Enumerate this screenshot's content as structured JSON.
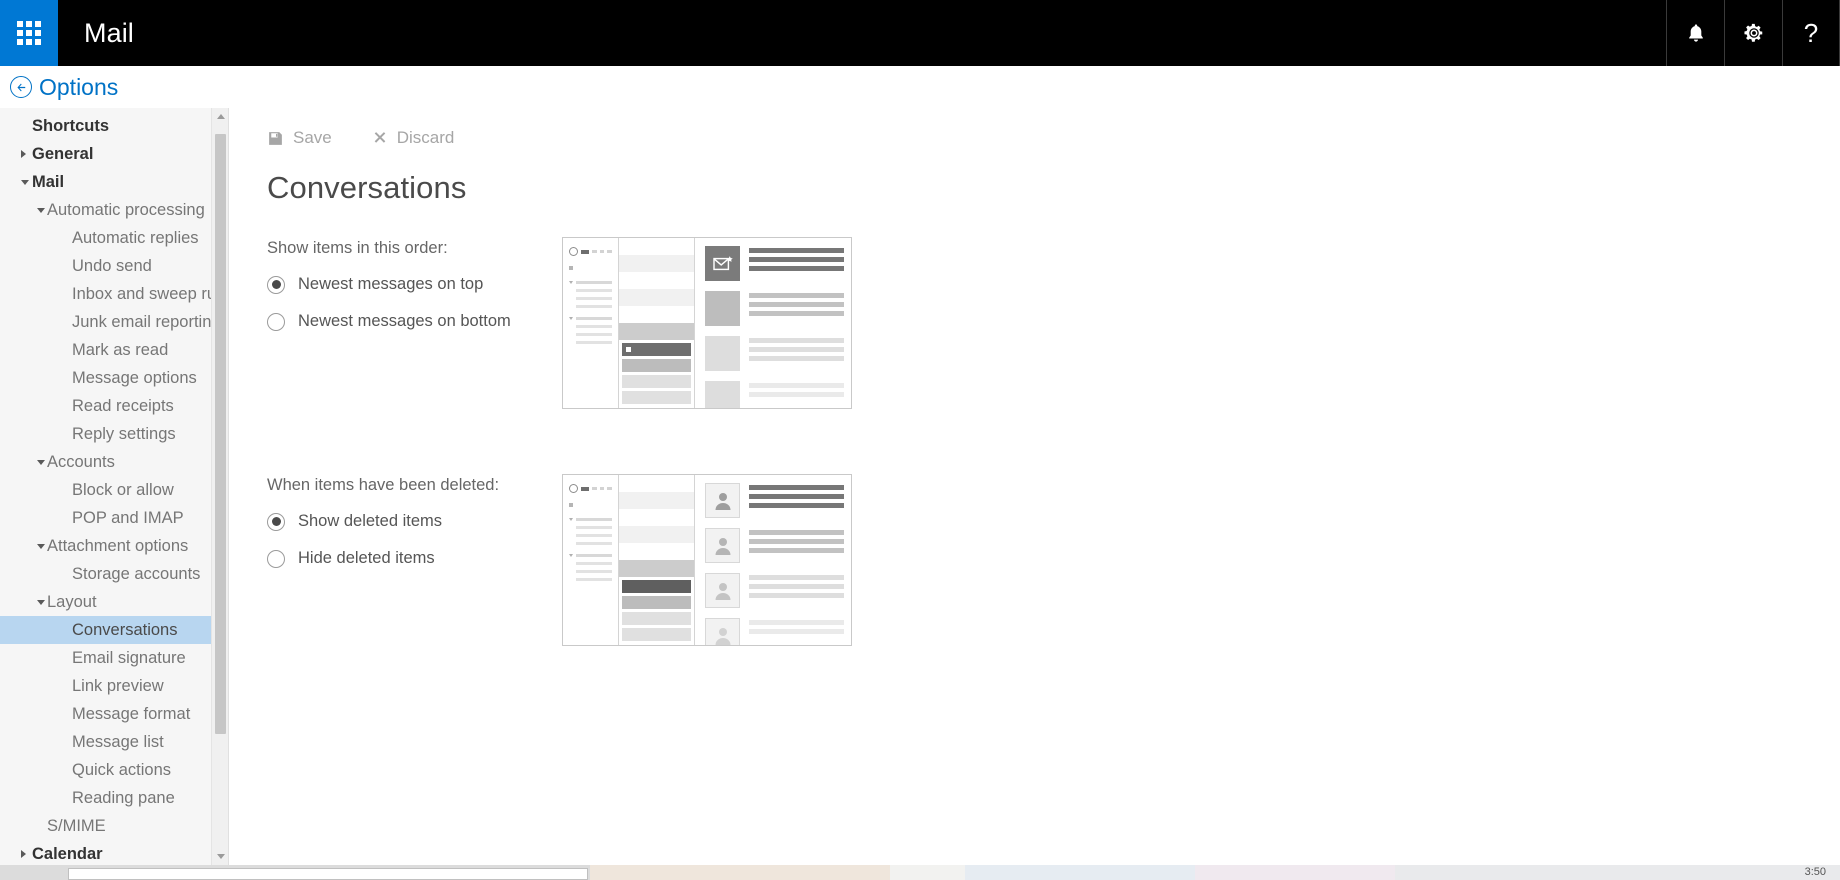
{
  "appbar": {
    "waffle_icon": "app-launcher-grid-icon",
    "title": "Mail",
    "notifications_icon": "bell-icon",
    "settings_icon": "gear-icon",
    "help_icon": "question-mark-icon",
    "help_glyph": "?",
    "background": "#000000",
    "waffle_background": "#0078d4"
  },
  "options_header": {
    "back_icon": "back-arrow-circle-icon",
    "label": "Options",
    "color": "#0072c6"
  },
  "sidebar": {
    "selected_color": "#b8d6f0",
    "items": [
      {
        "label": "Shortcuts",
        "level": 0,
        "caret": "none",
        "selected": false
      },
      {
        "label": "General",
        "level": 0,
        "caret": "right",
        "selected": false
      },
      {
        "label": "Mail",
        "level": 0,
        "caret": "down",
        "selected": false
      },
      {
        "label": "Automatic processing",
        "level": 1,
        "caret": "down",
        "selected": false
      },
      {
        "label": "Automatic replies",
        "level": 2,
        "caret": "none",
        "selected": false
      },
      {
        "label": "Undo send",
        "level": 2,
        "caret": "none",
        "selected": false
      },
      {
        "label": "Inbox and sweep rules",
        "level": 2,
        "caret": "none",
        "selected": false
      },
      {
        "label": "Junk email reporting",
        "level": 2,
        "caret": "none",
        "selected": false
      },
      {
        "label": "Mark as read",
        "level": 2,
        "caret": "none",
        "selected": false
      },
      {
        "label": "Message options",
        "level": 2,
        "caret": "none",
        "selected": false
      },
      {
        "label": "Read receipts",
        "level": 2,
        "caret": "none",
        "selected": false
      },
      {
        "label": "Reply settings",
        "level": 2,
        "caret": "none",
        "selected": false
      },
      {
        "label": "Accounts",
        "level": 1,
        "caret": "down",
        "selected": false
      },
      {
        "label": "Block or allow",
        "level": 2,
        "caret": "none",
        "selected": false
      },
      {
        "label": "POP and IMAP",
        "level": 2,
        "caret": "none",
        "selected": false
      },
      {
        "label": "Attachment options",
        "level": 1,
        "caret": "down",
        "selected": false
      },
      {
        "label": "Storage accounts",
        "level": 2,
        "caret": "none",
        "selected": false
      },
      {
        "label": "Layout",
        "level": 1,
        "caret": "down",
        "selected": false
      },
      {
        "label": "Conversations",
        "level": 2,
        "caret": "none",
        "selected": true
      },
      {
        "label": "Email signature",
        "level": 2,
        "caret": "none",
        "selected": false
      },
      {
        "label": "Link preview",
        "level": 2,
        "caret": "none",
        "selected": false
      },
      {
        "label": "Message format",
        "level": 2,
        "caret": "none",
        "selected": false
      },
      {
        "label": "Message list",
        "level": 2,
        "caret": "none",
        "selected": false
      },
      {
        "label": "Quick actions",
        "level": 2,
        "caret": "none",
        "selected": false
      },
      {
        "label": "Reading pane",
        "level": 2,
        "caret": "none",
        "selected": false
      },
      {
        "label": "S/MIME",
        "level": 1,
        "caret": "none",
        "selected": false
      },
      {
        "label": "Calendar",
        "level": 0,
        "caret": "right",
        "selected": false
      }
    ],
    "scrollbar": {
      "up_icon": "scroll-up-arrow-icon",
      "down_icon": "scroll-down-arrow-icon"
    }
  },
  "commandbar": {
    "save_label": "Save",
    "save_icon": "floppy-disk-save-icon",
    "discard_label": "Discard",
    "discard_icon": "x-close-icon",
    "disabled_color": "#a6a6a6"
  },
  "main": {
    "page_title": "Conversations",
    "sections": [
      {
        "label": "Show items in this order:",
        "options": [
          {
            "label": "Newest messages on top",
            "checked": true
          },
          {
            "label": "Newest messages on bottom",
            "checked": false
          }
        ]
      },
      {
        "label": "When items have been deleted:",
        "options": [
          {
            "label": "Show deleted items",
            "checked": true
          },
          {
            "label": "Hide deleted items",
            "checked": false
          }
        ]
      }
    ],
    "preview_order_icon": "conversation-order-preview",
    "preview_deleted_icon": "deleted-items-preview"
  },
  "statusbar": {
    "clock": "3:50"
  }
}
